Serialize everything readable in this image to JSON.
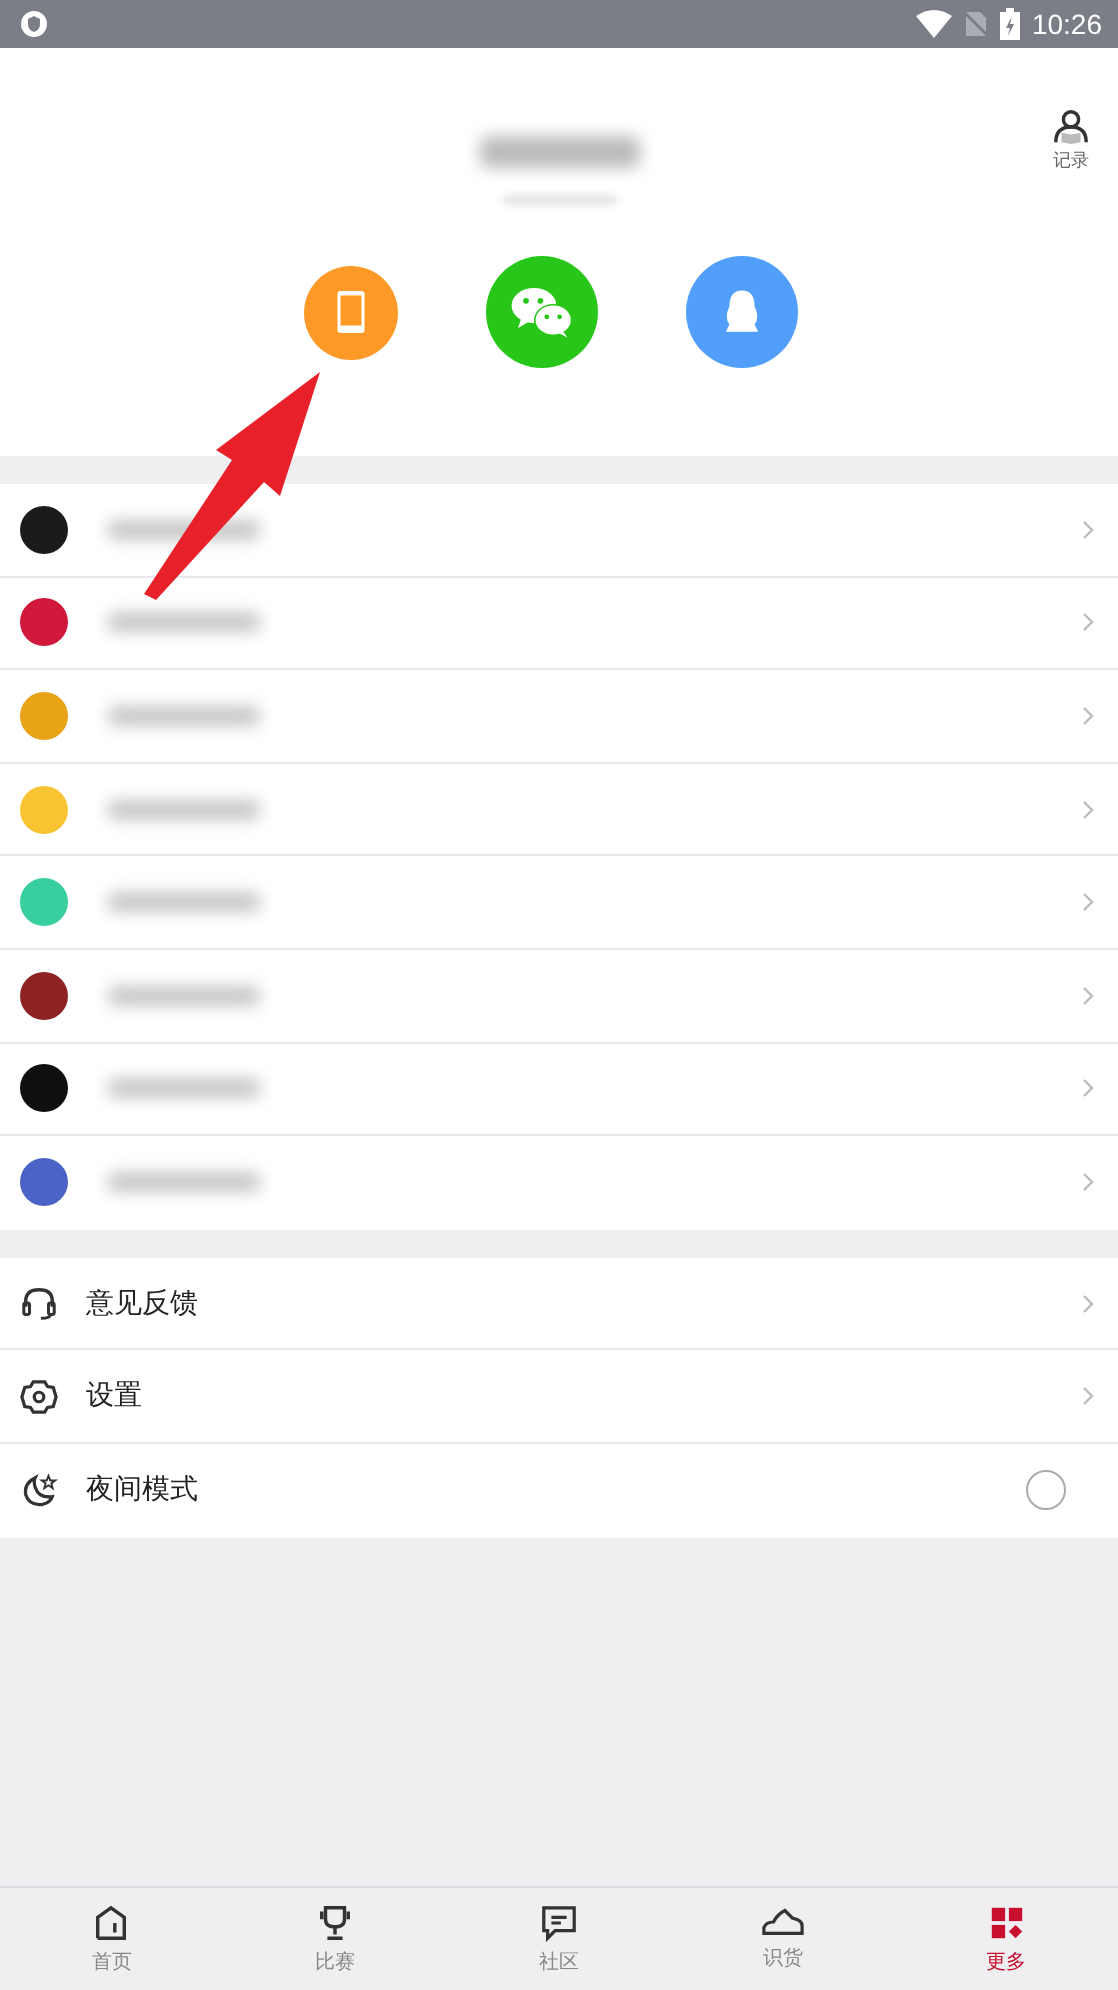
{
  "status_bar": {
    "time": "10:26"
  },
  "header": {
    "record_label": "记录",
    "login_options": [
      {
        "kind": "phone",
        "color": "#fd9a27"
      },
      {
        "kind": "wechat",
        "color": "#27c619"
      },
      {
        "kind": "qq",
        "color": "#519ffb"
      }
    ]
  },
  "apps": [
    {
      "color": "#1b1b1b"
    },
    {
      "color": "#d0183a"
    },
    {
      "color": "#e8a317"
    },
    {
      "color": "#f9c431"
    },
    {
      "color": "#37cf9f"
    },
    {
      "color": "#8c2222"
    },
    {
      "color": "#0f0f0f"
    },
    {
      "color": "#4b63c6"
    }
  ],
  "settings": [
    {
      "kind": "feedback",
      "label": "意见反馈"
    },
    {
      "kind": "settings",
      "label": "设置"
    },
    {
      "kind": "night",
      "label": "夜间模式",
      "on": false
    }
  ],
  "tab_bar": [
    {
      "kind": "home",
      "label": "首页",
      "selected": false
    },
    {
      "kind": "trophy",
      "label": "比赛",
      "selected": false
    },
    {
      "kind": "chat",
      "label": "社区",
      "selected": false
    },
    {
      "kind": "shoe",
      "label": "识货",
      "selected": false
    },
    {
      "kind": "more",
      "label": "更多",
      "selected": true
    }
  ]
}
